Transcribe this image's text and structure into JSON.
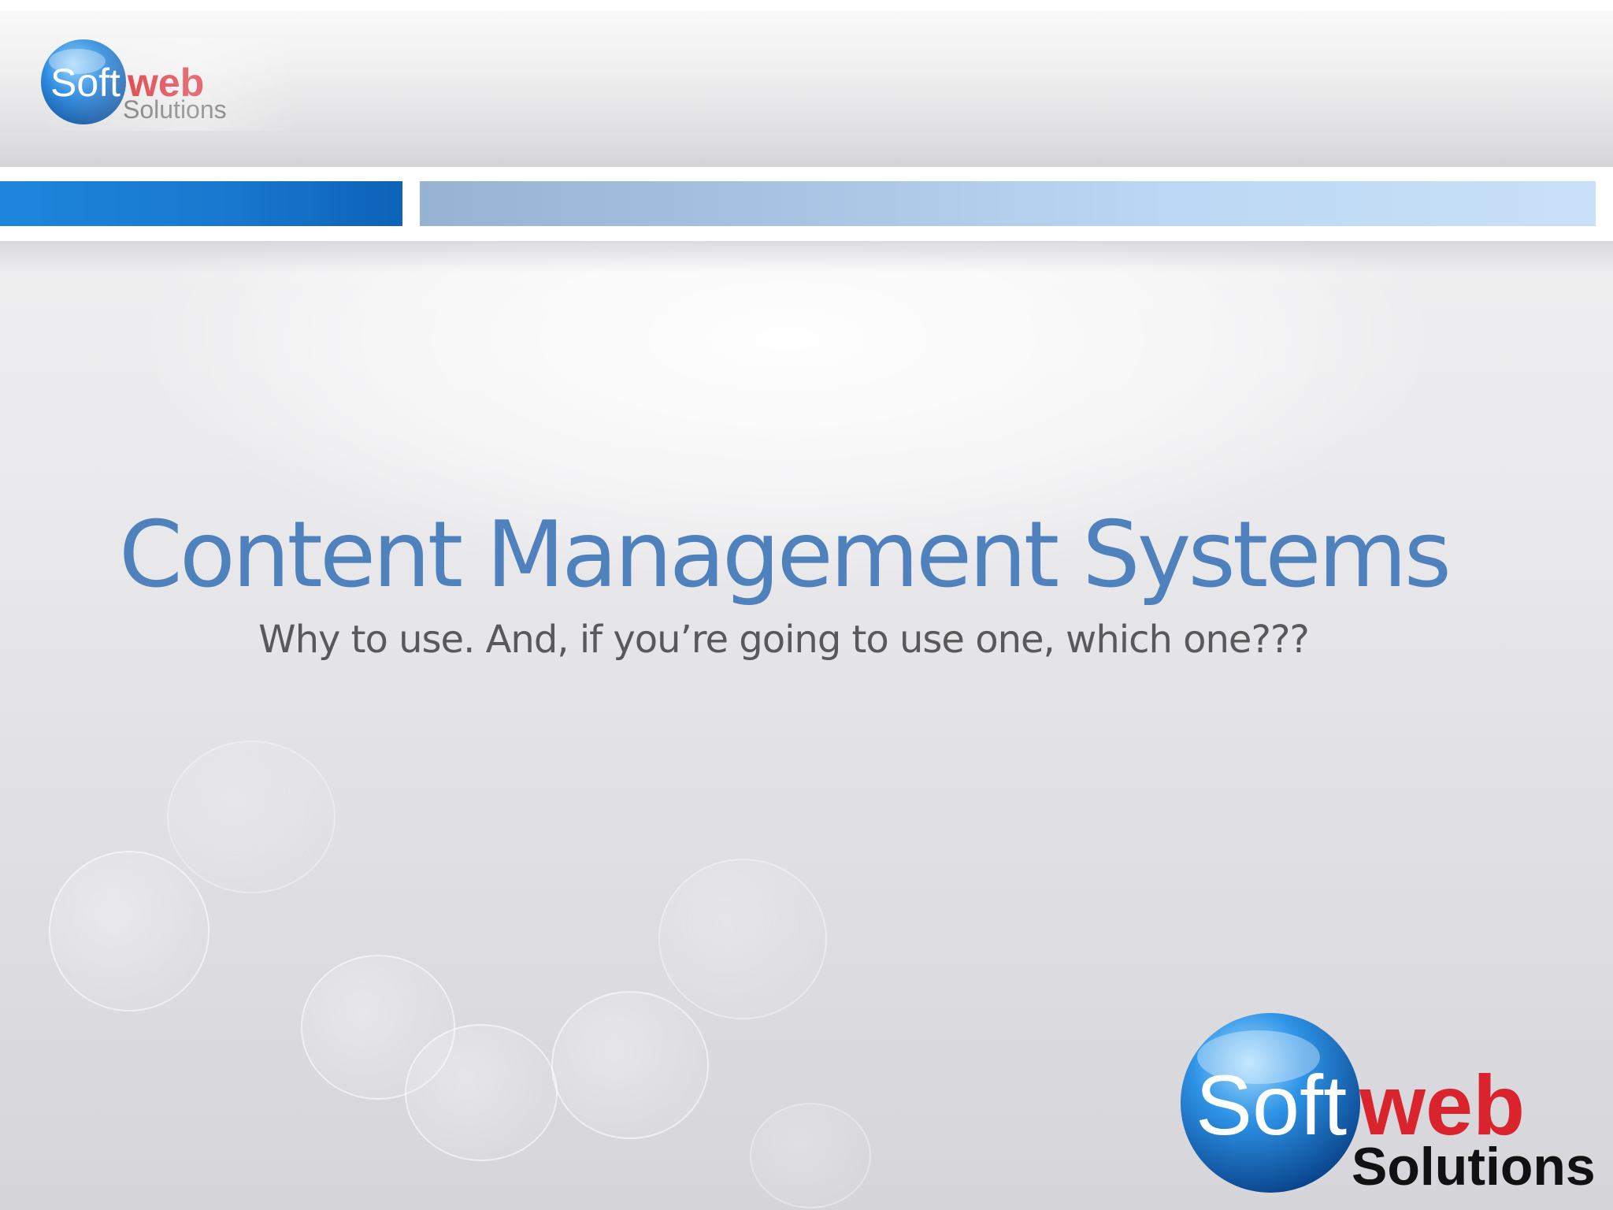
{
  "slide": {
    "title": "Content Management Systems",
    "subtitle": "Why to use. And, if you’re going to use one, which one???"
  },
  "branding": {
    "logo_text_soft": "Soft",
    "logo_text_web": "web",
    "logo_text_solutions": "Solutions"
  },
  "colors": {
    "title": "#4f81bd",
    "subtitle": "#595959",
    "accent_dark_bar": "#1978cf",
    "accent_light_bar": "#bcd8f4",
    "logo_red": "#d9232d",
    "logo_blue": "#1f6fc7"
  },
  "icons": {
    "logo_small": "softweb-logo",
    "logo_large": "softweb-logo"
  }
}
